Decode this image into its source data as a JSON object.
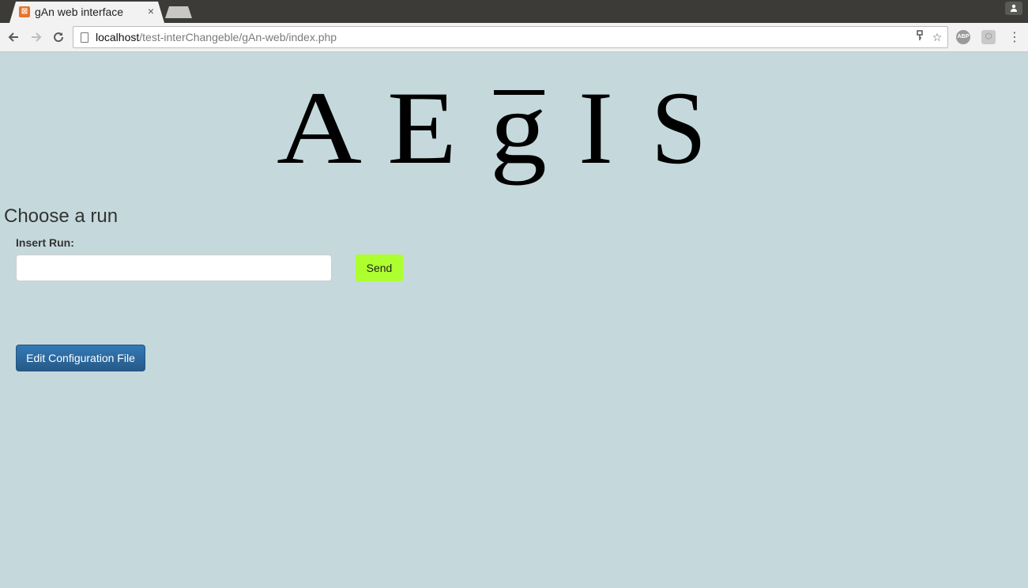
{
  "browser": {
    "tab_title": "gAn web interface",
    "tab_close": "×",
    "url_host": "localhost",
    "url_path": "/test-interChangeble/gAn-web/index.php",
    "icons": [
      "back-icon",
      "forward-icon",
      "reload-icon",
      "page-info-icon",
      "key-icon",
      "star-icon",
      "adblock-icon",
      "extension-icon",
      "menu-icon"
    ],
    "adblock_label": "ABP"
  },
  "page": {
    "logo_text": "AEgIS",
    "section_title": "Choose a run",
    "run_label": "Insert Run:",
    "run_input_value": "",
    "send_label": "Send",
    "edit_config_label": "Edit Configuration File"
  },
  "colors": {
    "page_background": "#c5d9dc",
    "send_button": "#adff2f",
    "edit_button": "#337ab7",
    "tab_favicon": "#e8742b"
  }
}
